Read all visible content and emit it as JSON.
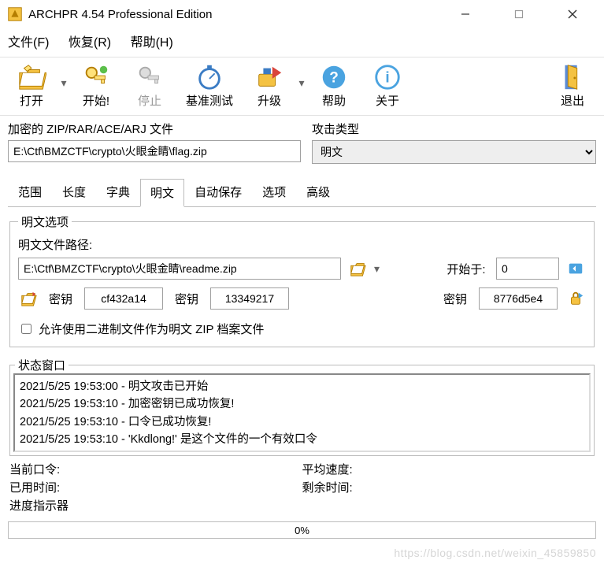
{
  "window": {
    "title": "ARCHPR 4.54 Professional Edition"
  },
  "menu": {
    "file": "文件(F)",
    "recover": "恢复(R)",
    "help": "帮助(H)"
  },
  "toolbar": {
    "open": "打开",
    "start": "开始!",
    "stop": "停止",
    "benchmark": "基准测试",
    "upgrade": "升级",
    "help": "帮助",
    "about": "关于",
    "exit": "退出"
  },
  "sections": {
    "encrypted_label": "加密的 ZIP/RAR/ACE/ARJ 文件",
    "encrypted_path": "E:\\Ctf\\BMZCTF\\crypto\\火眼金睛\\flag.zip",
    "attack_type_label": "攻击类型",
    "attack_type_value": "明文"
  },
  "tabs": {
    "range": "范围",
    "length": "长度",
    "dict": "字典",
    "plaintext": "明文",
    "autosave": "自动保存",
    "options": "选项",
    "advanced": "高级"
  },
  "plaintext": {
    "group_title": "明文选项",
    "path_label": "明文文件路径:",
    "path_value": "E:\\Ctf\\BMZCTF\\crypto\\火眼金睛\\readme.zip",
    "start_at_label": "开始于:",
    "start_at_value": "0",
    "key_label": "密钥",
    "key1": "cf432a14",
    "key2": "13349217",
    "key3": "8776d5e4",
    "allow_binary": "允许使用二进制文件作为明文 ZIP 档案文件"
  },
  "status": {
    "group_title": "状态窗口",
    "lines": [
      "2021/5/25 19:53:00 - 明文攻击已开始",
      "2021/5/25 19:53:10 - 加密密钥已成功恢复!",
      "2021/5/25 19:53:10 - 口令已成功恢复!",
      "2021/5/25 19:53:10 - 'Kkdlong!' 是这个文件的一个有效口令"
    ]
  },
  "footer": {
    "current_pw": "当前口令:",
    "used_time": "已用时间:",
    "progress_indicator": "进度指示器",
    "avg_speed": "平均速度:",
    "remaining": "剩余时间:",
    "progress_text": "0%"
  },
  "watermark": "https://blog.csdn.net/weixin_45859850"
}
